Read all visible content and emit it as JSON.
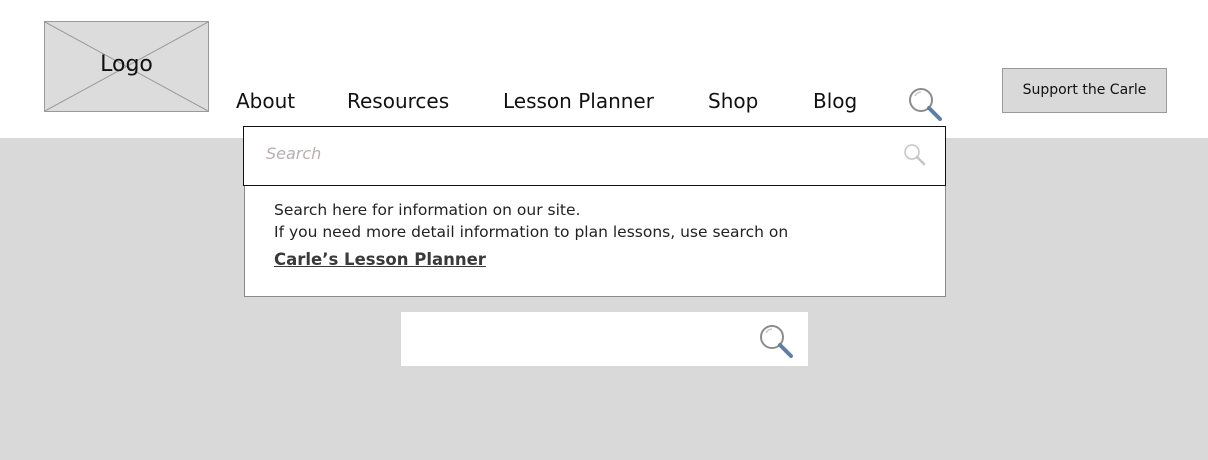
{
  "header": {
    "logo_text": "Logo",
    "nav": [
      {
        "label": "About"
      },
      {
        "label": "Resources"
      },
      {
        "label": "Lesson Planner"
      },
      {
        "label": "Shop"
      },
      {
        "label": "Blog"
      }
    ],
    "search_icon": "search-icon",
    "support_button": "Support the Carle"
  },
  "search_dropdown": {
    "placeholder": "Search",
    "field_icon": "search-icon",
    "hint_line_1": "Search here for information on our site.",
    "hint_line_2": "If you need more detail information to plan lessons, use search on",
    "planner_link": "Carle’s Lesson Planner"
  },
  "bottom_search": {
    "value": "",
    "icon": "search-icon"
  },
  "colors": {
    "background_gray": "#d9d9d9",
    "placeholder_gray": "#b8b0b0",
    "border_gray": "#9a9a9a"
  }
}
